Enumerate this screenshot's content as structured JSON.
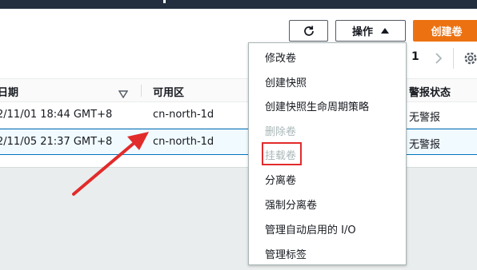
{
  "toolbar": {
    "actions_label": "操作",
    "create_label": "创建卷"
  },
  "pagination": {
    "current_page": "1"
  },
  "table": {
    "columns": {
      "date": "日期",
      "zone": "可用区",
      "alarm": "警报状态"
    },
    "rows": [
      {
        "date": "2/11/01 18:44 GMT+8",
        "zone": "cn-north-1d",
        "alarm": "无警报"
      },
      {
        "date": "2/11/05 21:37 GMT+8",
        "zone": "cn-north-1d",
        "alarm": "无警报"
      }
    ]
  },
  "menu": {
    "items": [
      {
        "label": "修改卷",
        "disabled": false
      },
      {
        "label": "创建快照",
        "disabled": false
      },
      {
        "label": "创建快照生命周期策略",
        "disabled": false
      },
      {
        "label": "删除卷",
        "disabled": true
      },
      {
        "label": "挂载卷",
        "disabled": true
      },
      {
        "label": "分离卷",
        "disabled": false
      },
      {
        "label": "强制分离卷",
        "disabled": false
      },
      {
        "label": "管理自动启用的 I/O",
        "disabled": false
      },
      {
        "label": "管理标签",
        "disabled": false
      }
    ]
  },
  "colors": {
    "accent": "#ec7211",
    "selected_row_bg": "#f1faff",
    "selected_row_border": "#0073bb",
    "annotation_red": "#e22b2b",
    "disabled_text": "#aab7b8"
  },
  "icons": {
    "refresh": "refresh-icon",
    "caret_up": "caret-up-icon",
    "pager_next": "chevron-right-icon",
    "settings": "gear-icon",
    "sort": "sort-down-icon"
  }
}
